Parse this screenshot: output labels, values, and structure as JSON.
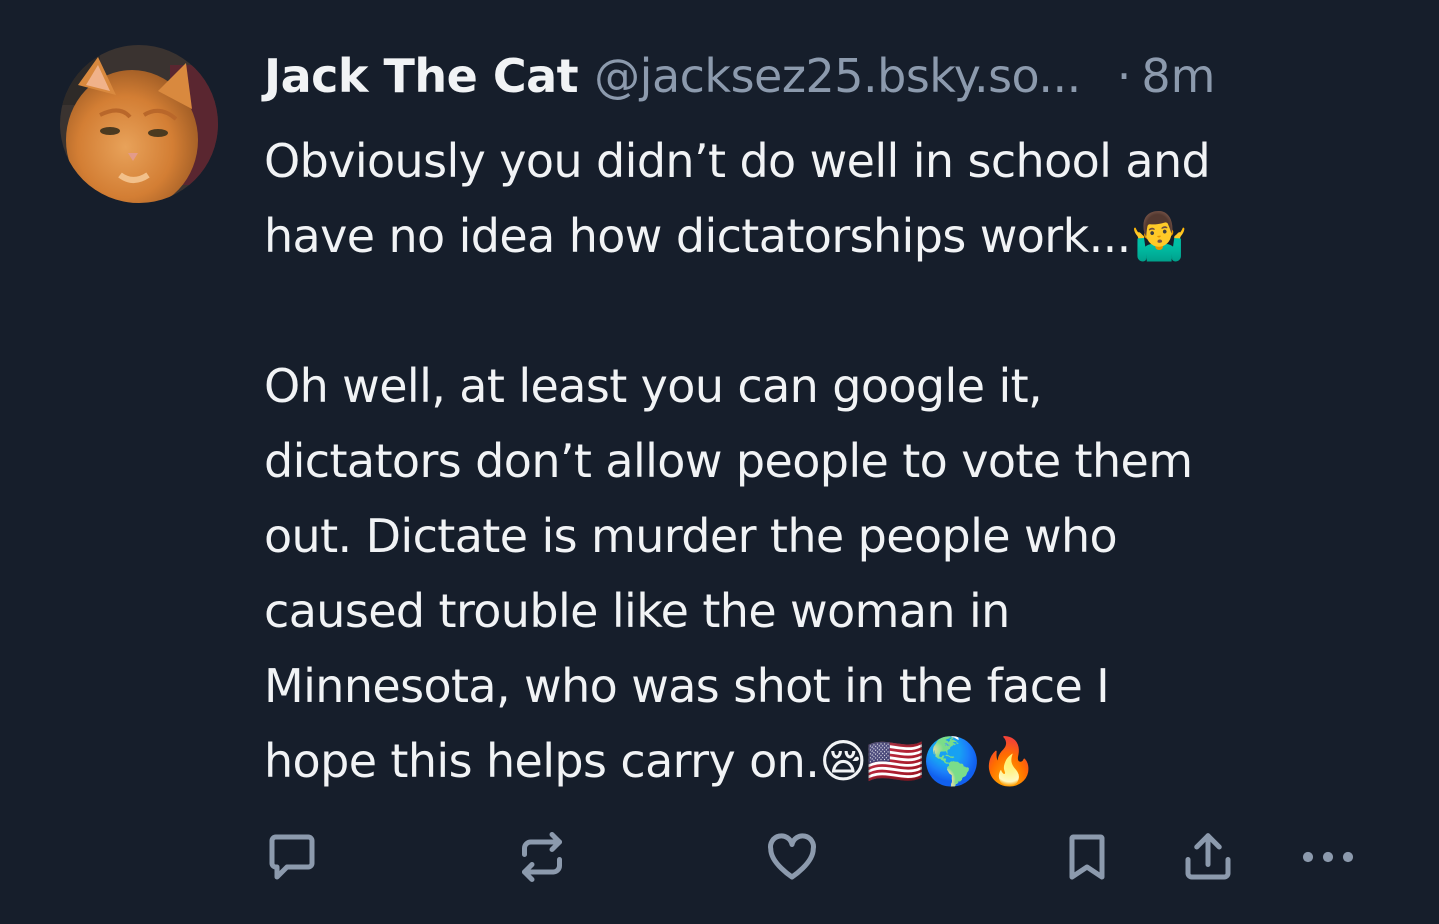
{
  "post": {
    "author": {
      "display_name": "Jack The Cat",
      "handle": "@jacksez25.bsky.so..."
    },
    "separator": "·",
    "time": "8m",
    "text": {
      "paragraph_1": "Obviously you didn’t do well in school and\nhave no idea how dictatorships work...🤷‍♂️",
      "paragraph_2": "Oh well, at least you can google it,\ndictators don’t allow people to vote them\nout. Dictate is murder the people who\ncaused trouble like the woman in\nMinnesota, who was shot in the face I\nhope this helps carry on.😪🇺🇸🌎🔥"
    },
    "actions": [
      {
        "name": "reply",
        "icon": "speech-bubble-icon"
      },
      {
        "name": "repost",
        "icon": "repost-icon"
      },
      {
        "name": "like",
        "icon": "heart-icon"
      },
      {
        "name": "bookmark",
        "icon": "bookmark-icon"
      },
      {
        "name": "share",
        "icon": "share-icon"
      },
      {
        "name": "more",
        "icon": "ellipsis-icon"
      }
    ]
  },
  "colors": {
    "background": "#161e2b",
    "text_primary": "#f1f3f5",
    "text_secondary": "#8c9aad",
    "icon": "#8c9aad"
  }
}
